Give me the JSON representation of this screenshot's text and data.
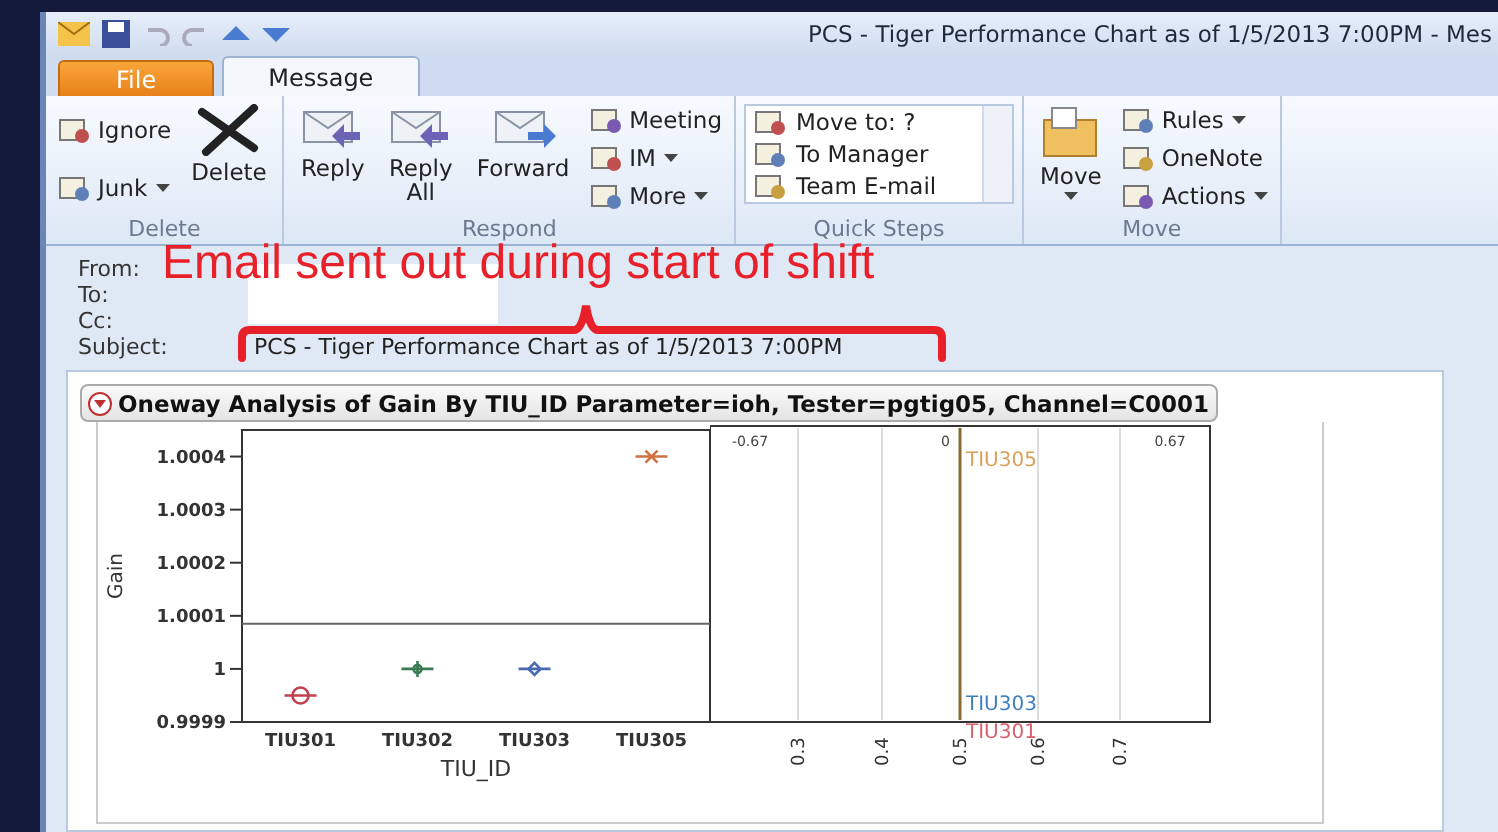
{
  "window": {
    "title": "PCS - Tiger Performance Chart as of 1/5/2013 7:00PM  -  Mes"
  },
  "tabs": [
    {
      "label": "File",
      "kind": "file",
      "selected": false
    },
    {
      "label": "Message",
      "kind": "tab",
      "selected": true
    }
  ],
  "ribbon": [
    {
      "label": "Delete",
      "items": [
        {
          "kind": "small",
          "label": "Ignore",
          "dropdown": false
        },
        {
          "kind": "small",
          "label": "Junk",
          "dropdown": true
        },
        {
          "kind": "large",
          "label": "Delete",
          "dropdown": false
        }
      ]
    },
    {
      "label": "Respond",
      "items": [
        {
          "kind": "large",
          "label": "Reply",
          "dropdown": false
        },
        {
          "kind": "large",
          "label": "Reply All",
          "dropdown": false
        },
        {
          "kind": "large",
          "label": "Forward",
          "dropdown": false
        },
        {
          "kind": "small",
          "label": "Meeting",
          "dropdown": false
        },
        {
          "kind": "small",
          "label": "IM",
          "dropdown": true
        },
        {
          "kind": "small",
          "label": "More",
          "dropdown": true
        }
      ]
    },
    {
      "label": "Quick Steps",
      "items": [
        {
          "kind": "quick",
          "label": "Move to: ?"
        },
        {
          "kind": "quick",
          "label": "To Manager"
        },
        {
          "kind": "quick",
          "label": "Team E-mail"
        }
      ]
    },
    {
      "label": "Move",
      "items": [
        {
          "kind": "large",
          "label": "Move",
          "dropdown": true
        },
        {
          "kind": "small",
          "label": "Rules",
          "dropdown": true
        },
        {
          "kind": "small",
          "label": "OneNote",
          "dropdown": false
        },
        {
          "kind": "small",
          "label": "Actions",
          "dropdown": true
        }
      ]
    }
  ],
  "header": [
    {
      "label": "From:"
    },
    {
      "label": "To:"
    },
    {
      "label": "Cc:"
    },
    {
      "label": "Subject:",
      "value": "PCS - Tiger Performance Chart as of 1/5/2013 7:00PM"
    }
  ],
  "annotation": "Email sent out during start of shift",
  "report": {
    "title": "Oneway Analysis of Gain By TIU_ID Parameter=ioh, Tester=pgtig05, Channel=C0001",
    "chart_data": {
      "type": "scatter",
      "xlabel": "TIU_ID",
      "ylabel": "Gain",
      "categories": [
        "TIU301",
        "TIU302",
        "TIU303",
        "TIU305"
      ],
      "values": [
        0.99995,
        1,
        1,
        1.0004
      ],
      "ref_lines": [
        {
          "axis": "y",
          "value": 1.000085
        }
      ],
      "ylim": [
        0.9999,
        1.00045
      ],
      "yticks": [
        {
          "value": 0.9999,
          "label": "0.9999"
        },
        {
          "value": 1,
          "label": "1"
        },
        {
          "value": 1.0001,
          "label": "1.0001"
        },
        {
          "value": 1.0002,
          "label": "1.0002"
        },
        {
          "value": 1.0003,
          "label": "1.0003"
        },
        {
          "value": 1.0004,
          "label": "1.0004"
        }
      ]
    },
    "quantile": {
      "top_ticks": [
        "-0.67",
        "0",
        "0.67"
      ],
      "bottom_ticks": [
        "0.3",
        "0.4",
        "0.5",
        "0.6",
        "0.7"
      ],
      "labels": [
        {
          "text": "TIU305",
          "color": "#d9a05a"
        },
        {
          "text": "TIU303",
          "color": "#3f7fbf"
        },
        {
          "text": "TIU301",
          "color": "#d9606a"
        }
      ]
    }
  }
}
